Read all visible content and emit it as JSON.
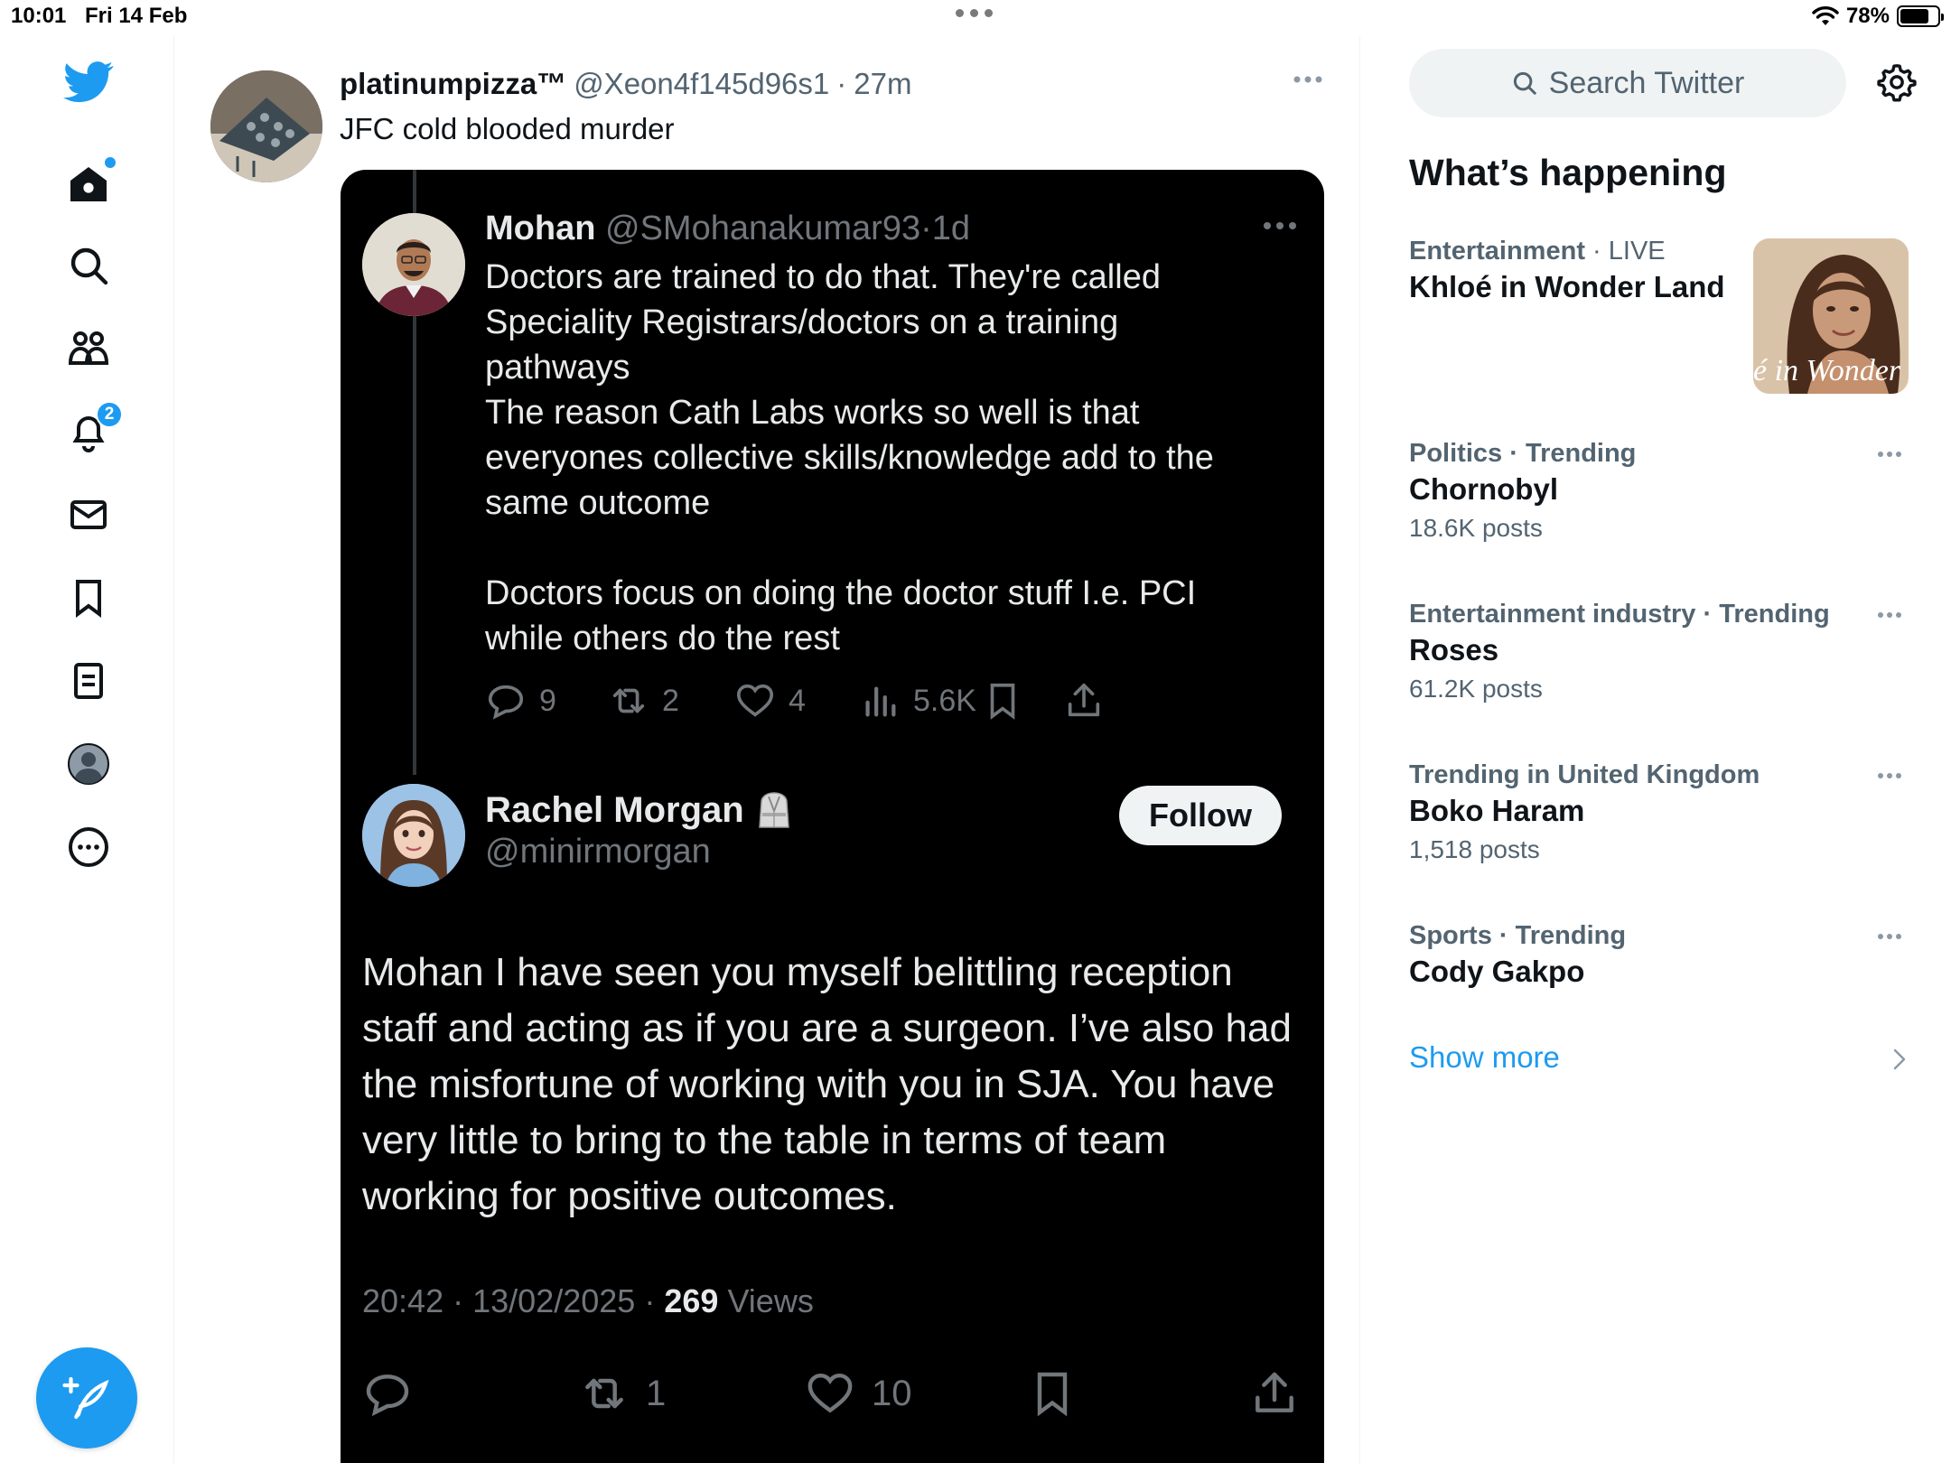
{
  "status_bar": {
    "time": "10:01",
    "date": "Fri 14 Feb",
    "battery": "78%",
    "battery_level": 0.78
  },
  "nav": {
    "items": [
      {
        "name": "home",
        "icon": "home-icon",
        "badge_dot": true
      },
      {
        "name": "explore",
        "icon": "search-icon"
      },
      {
        "name": "communities",
        "icon": "people-icon"
      },
      {
        "name": "notifications",
        "icon": "bell-icon",
        "badge": "2"
      },
      {
        "name": "messages",
        "icon": "mail-icon"
      },
      {
        "name": "bookmarks",
        "icon": "bookmark-icon"
      },
      {
        "name": "lists",
        "icon": "list-icon"
      },
      {
        "name": "profile",
        "icon": "avatar-icon"
      },
      {
        "name": "more",
        "icon": "more-circle-icon"
      }
    ],
    "compose_icon": "feather-plus-icon"
  },
  "post": {
    "name": "platinumpizza™",
    "handle": "@Xeon4f145d96s1",
    "sep": "·",
    "time": "27m",
    "text": "JFC cold blooded murder"
  },
  "embedded": {
    "mohan": {
      "name": "Mohan",
      "handle": "@SMohanakumar93",
      "sep": "·",
      "time": "1d",
      "lines": [
        "Doctors are trained to do that. They're called",
        "Speciality Registrars/doctors on a training",
        "pathways",
        "The reason Cath Labs works so well is that",
        "everyones collective skills/knowledge add to the",
        "same outcome",
        "",
        "Doctors focus on doing the doctor stuff I.e. PCI",
        "while others do the rest"
      ],
      "replies": "9",
      "reposts": "2",
      "likes": "4",
      "views": "5.6K"
    },
    "rachel": {
      "name": "Rachel Morgan",
      "handle": "@minirmorgan",
      "follow_label": "Follow",
      "text": "Mohan I have seen you myself belittling reception staff and acting as if you are a surgeon. I’ve also had the misfortune of working with you in SJA. You have very little to bring to the table in terms of team working for positive outcomes.",
      "time": "20:42",
      "sep": "·",
      "date": "13/02/2025",
      "views_count": "269",
      "views_label": "Views",
      "reposts": "1",
      "likes": "10"
    }
  },
  "sidebar": {
    "search_placeholder": "Search Twitter",
    "section_title": "What’s happening",
    "trends": [
      {
        "category": "Entertainment",
        "sep": "·",
        "qualifier": "LIVE",
        "title": "Khloé in Wonder Land",
        "count": ""
      },
      {
        "category": "Politics",
        "sep": "·",
        "qualifier": "Trending",
        "title": "Chornobyl",
        "count": "18.6K posts"
      },
      {
        "category": "Entertainment industry",
        "sep": "·",
        "qualifier": "Trending",
        "title": "Roses",
        "count": "61.2K posts"
      },
      {
        "category": "Trending in United Kingdom",
        "sep": "",
        "qualifier": "",
        "title": "Boko Haram",
        "count": "1,518 posts"
      },
      {
        "category": "Sports",
        "sep": "·",
        "qualifier": "Trending",
        "title": "Cody Gakpo",
        "count": ""
      }
    ],
    "thumb_caption": "é in Wonder L",
    "show_more": "Show more"
  },
  "colors": {
    "accent": "#1d9bf0",
    "text": "#0f1419",
    "muted": "#536471",
    "dark_bg": "#000000",
    "dark_text": "#e7e9ea",
    "dark_muted": "#71767b"
  }
}
